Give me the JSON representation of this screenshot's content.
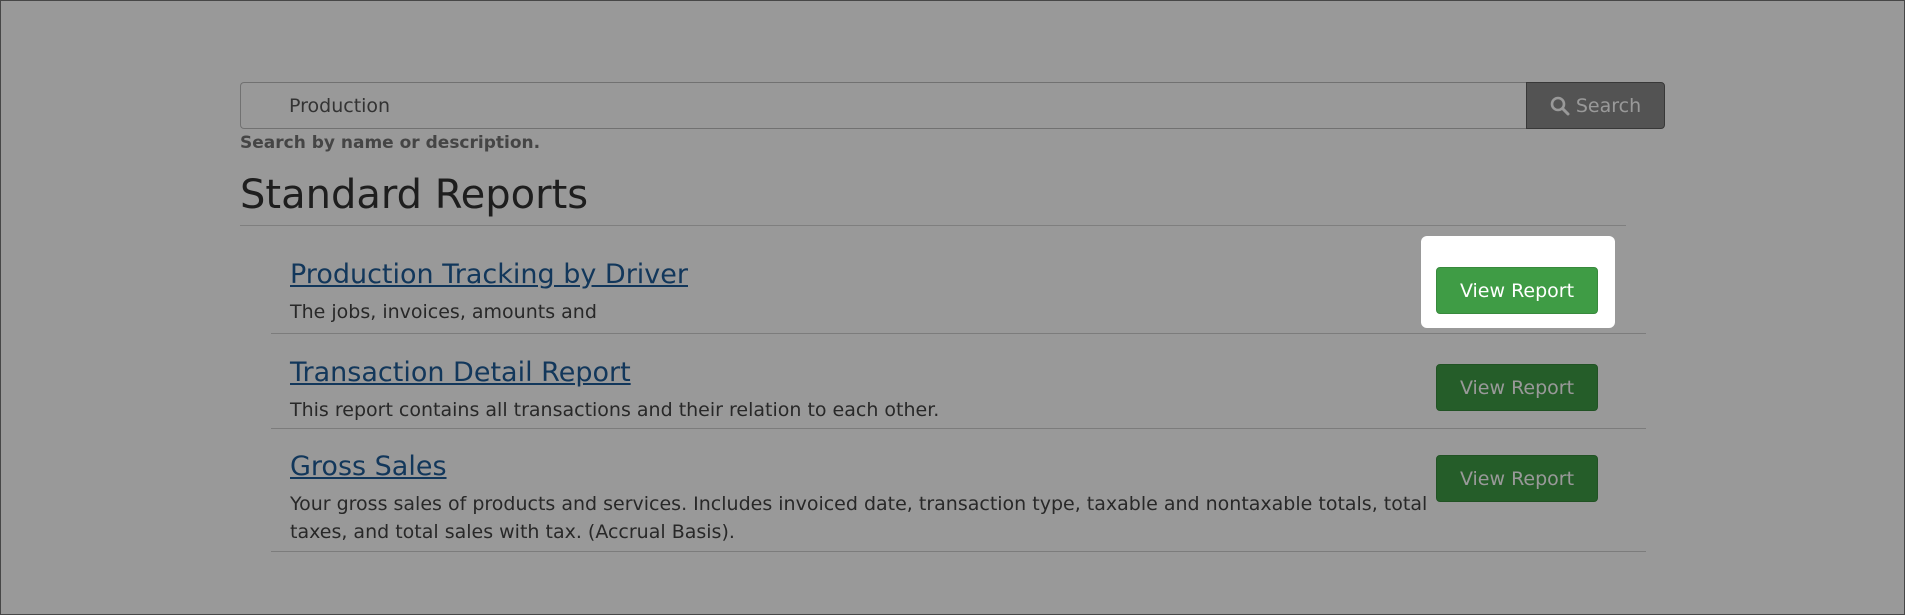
{
  "search": {
    "value": "Production",
    "button_label": "Search",
    "help_text": "Search by name or description."
  },
  "section": {
    "title": "Standard Reports"
  },
  "reports": [
    {
      "title": "Production Tracking by Driver",
      "description": "The jobs, invoices, amounts and",
      "button_label": "View Report"
    },
    {
      "title": "Transaction Detail Report",
      "description": "This report contains all transactions and their relation to each other.",
      "button_label": "View Report"
    },
    {
      "title": "Gross Sales",
      "description": "Your gross sales of products and services. Includes invoiced date, transaction type, taxable and nontaxable totals, total taxes, and total sales with tax. (Accrual Basis).",
      "button_label": "View Report"
    }
  ],
  "icons": {
    "search_button_icon": "search-icon"
  },
  "colors": {
    "link": "#1e5c98",
    "view_button": "#3f9c45",
    "overlay": "rgba(0,0,0,0.4)"
  },
  "highlight": {
    "target": "reports.0.button_label"
  }
}
